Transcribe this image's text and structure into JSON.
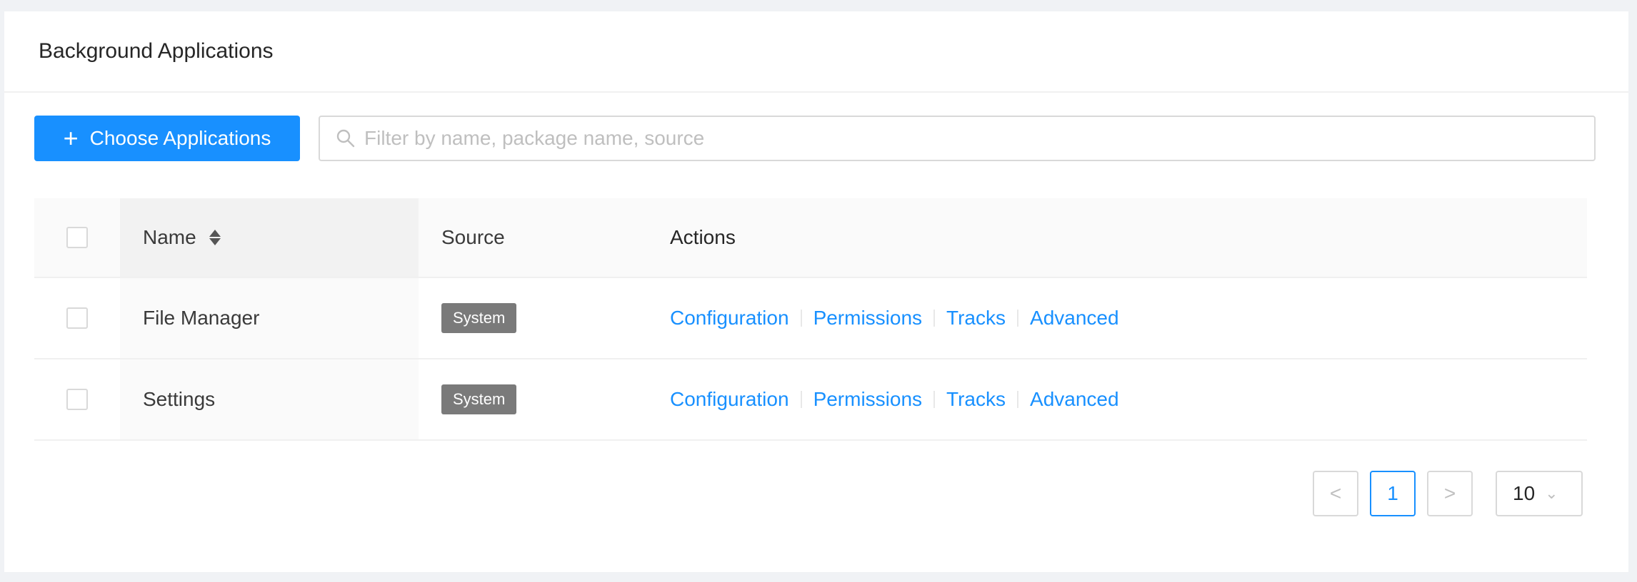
{
  "header": {
    "title": "Background Applications"
  },
  "toolbar": {
    "choose_label": "Choose Applications",
    "search_placeholder": "Filter by name, package name, source"
  },
  "table": {
    "columns": {
      "name": "Name",
      "source": "Source",
      "actions": "Actions"
    },
    "rows": [
      {
        "name": "File Manager",
        "source": "System",
        "actions": [
          "Configuration",
          "Permissions",
          "Tracks",
          "Advanced"
        ]
      },
      {
        "name": "Settings",
        "source": "System",
        "actions": [
          "Configuration",
          "Permissions",
          "Tracks",
          "Advanced"
        ]
      }
    ]
  },
  "pagination": {
    "prev": "<",
    "current_page": "1",
    "next": ">",
    "page_size": "10"
  },
  "colors": {
    "primary": "#1890ff",
    "tag": "#7a7a7a",
    "background": "#f0f2f5"
  }
}
